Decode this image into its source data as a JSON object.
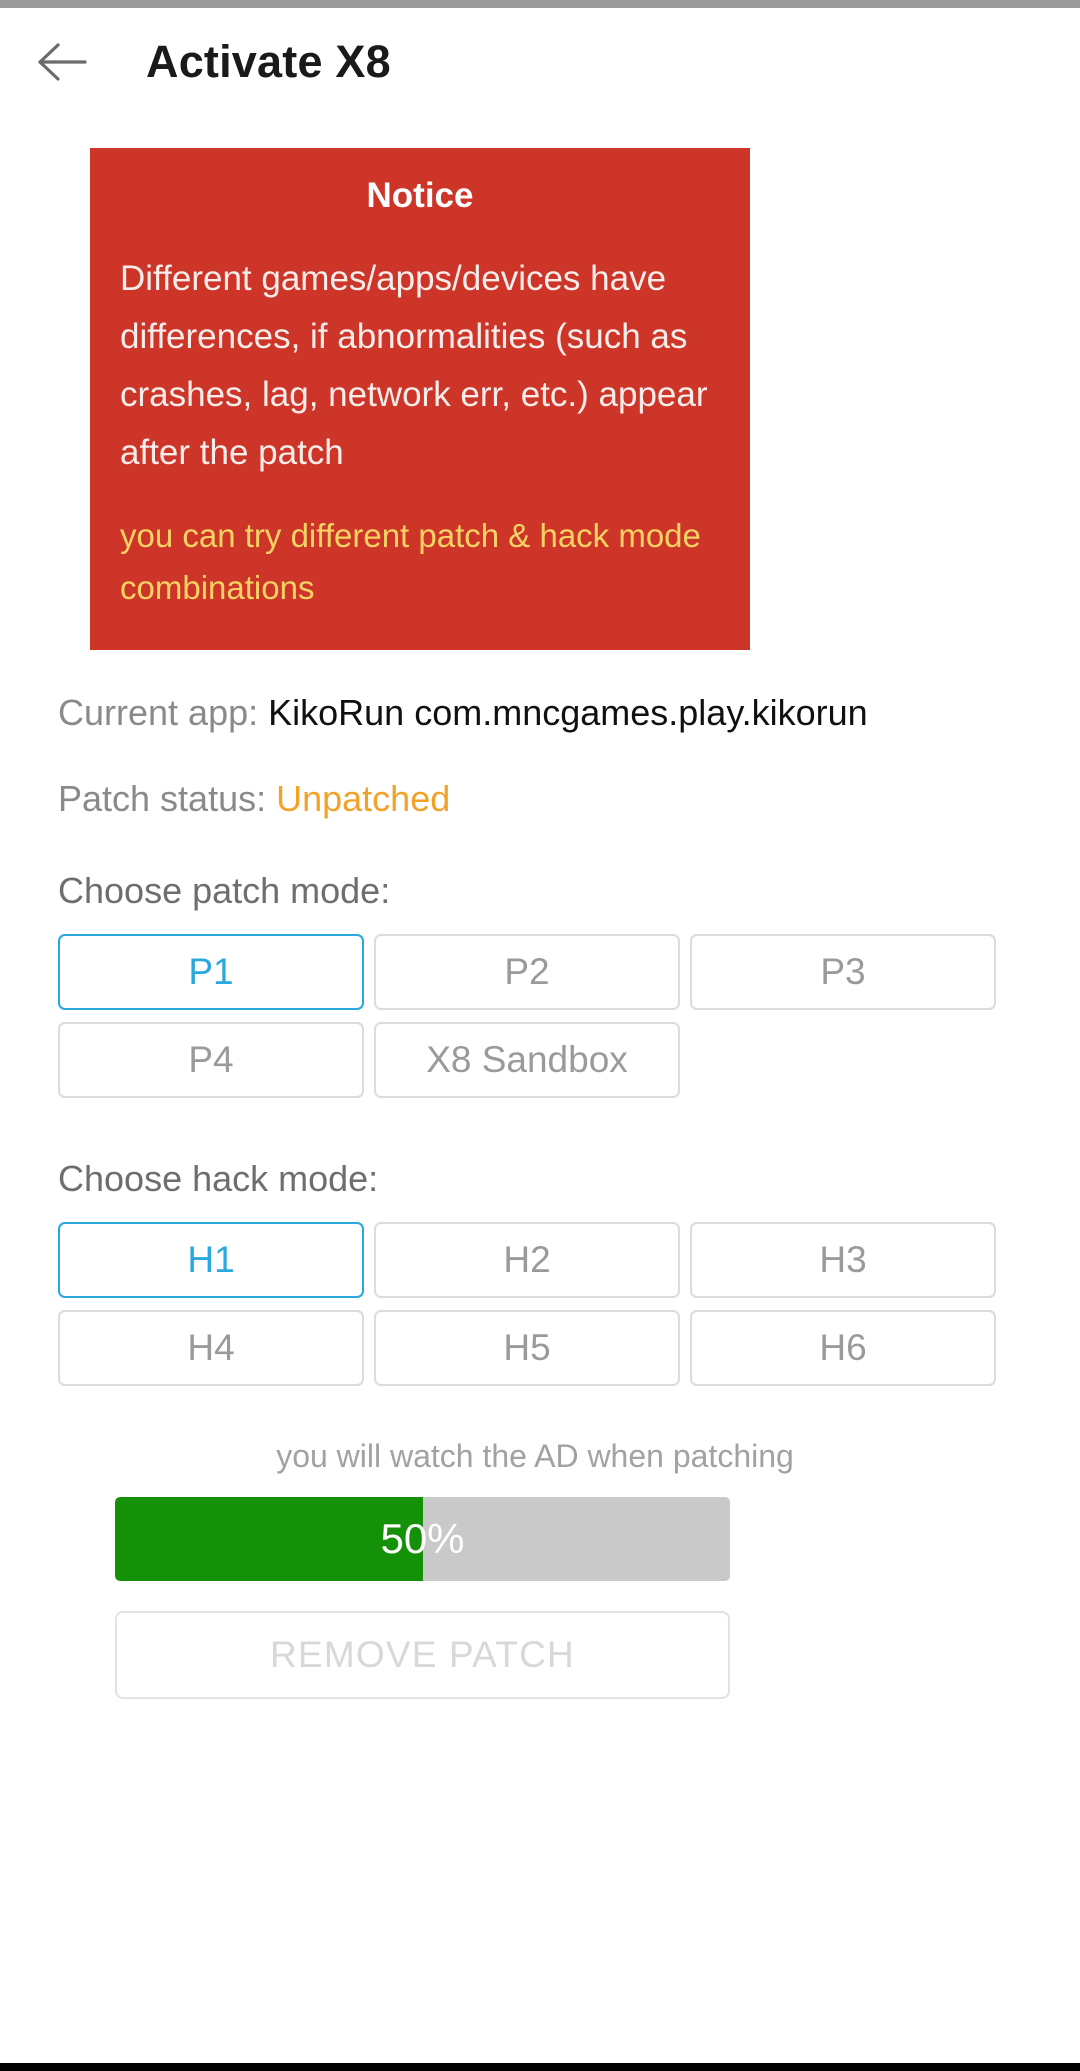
{
  "app_bar": {
    "back_icon": "back-arrow-icon",
    "title": "Activate X8"
  },
  "notice": {
    "title": "Notice",
    "body": "Different games/apps/devices have differences, if abnormalities (such as crashes, lag, network err, etc.) appear after the patch",
    "highlight": "you can try different patch & hack mode combinations",
    "background_color": "#cd3529",
    "highlight_color": "#f7d364"
  },
  "current_app": {
    "label": "Current app: ",
    "value": "KikoRun com.mncgames.play.kikorun"
  },
  "patch_status": {
    "label": "Patch status: ",
    "value": "Unpatched",
    "value_color": "#f2a228"
  },
  "patch_mode": {
    "label": "Choose patch mode:",
    "selected": "P1",
    "options": [
      "P1",
      "P2",
      "P3",
      "P4",
      "X8 Sandbox"
    ]
  },
  "hack_mode": {
    "label": "Choose hack mode:",
    "selected": "H1",
    "options": [
      "H1",
      "H2",
      "H3",
      "H4",
      "H5",
      "H6"
    ]
  },
  "progress": {
    "note": "you will watch the AD when patching",
    "percent": 50,
    "percent_label": "50%",
    "fill_color": "#159009",
    "track_color": "#c9c9c9"
  },
  "remove_patch": {
    "label": "REMOVE PATCH"
  },
  "accent_color": "#29a8df"
}
